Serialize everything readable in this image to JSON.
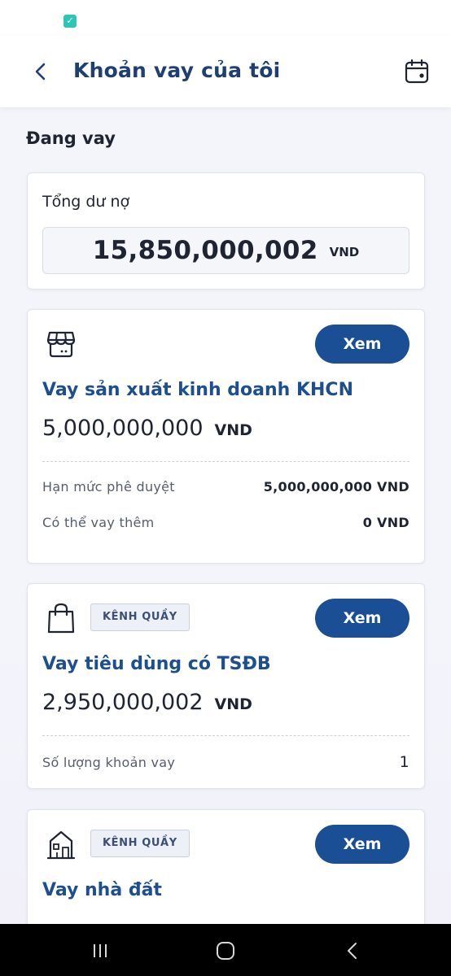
{
  "header": {
    "title": "Khoản vay của tôi"
  },
  "section": {
    "title": "Đang vay"
  },
  "total": {
    "label": "Tổng dư nợ",
    "amount": "15,850,000,002",
    "currency": "VND"
  },
  "loans": [
    {
      "icon": "shop-icon",
      "name": "Vay sản xuất kinh doanh KHCN",
      "amount": "5,000,000,000",
      "currency": "VND",
      "view_label": "Xem",
      "rows": [
        {
          "label": "Hạn mức phê duyệt",
          "value": "5,000,000,000 VND"
        },
        {
          "label": "Có thể vay thêm",
          "value": "0 VND"
        }
      ]
    },
    {
      "icon": "shopping-bag-icon",
      "channel": "KÊNH QUẦY",
      "name": "Vay tiêu dùng có TSĐB",
      "amount": "2,950,000,002",
      "currency": "VND",
      "view_label": "Xem",
      "rows": [
        {
          "label": "Số lượng khoản vay",
          "value": "1"
        }
      ]
    },
    {
      "icon": "house-icon",
      "channel": "KÊNH QUẦY",
      "name": "Vay nhà đất",
      "view_label": "Xem"
    }
  ],
  "colors": {
    "primary": "#1a4f95",
    "title": "#1d3f72",
    "loan_name": "#1d4f8f"
  }
}
